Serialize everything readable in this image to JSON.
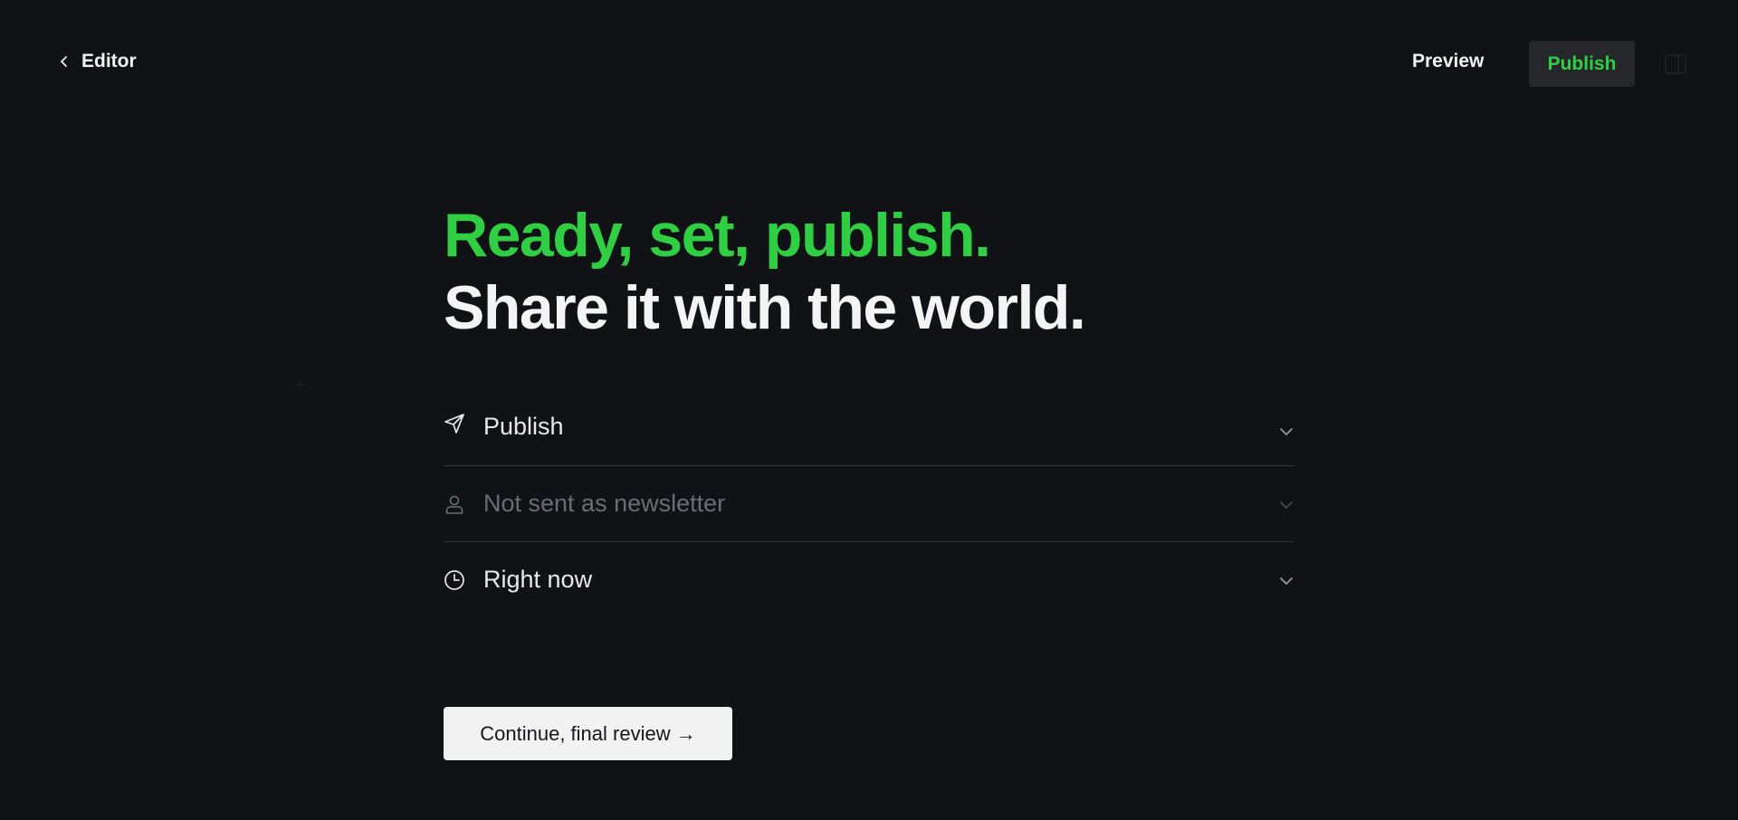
{
  "topbar": {
    "back_label": "Editor",
    "preview_label": "Preview",
    "publish_label": "Publish"
  },
  "headline": {
    "line1": "Ready, set, publish.",
    "line2": "Share it with the world."
  },
  "settings": [
    {
      "label": "Publish",
      "icon": "send-icon"
    },
    {
      "label": "Not sent as newsletter",
      "icon": "user-icon"
    },
    {
      "label": "Right now",
      "icon": "clock-icon"
    }
  ],
  "continue_label": "Continue, final review →",
  "colors": {
    "accent": "#30cf43",
    "background": "#111215",
    "button_bg": "#25272b"
  }
}
